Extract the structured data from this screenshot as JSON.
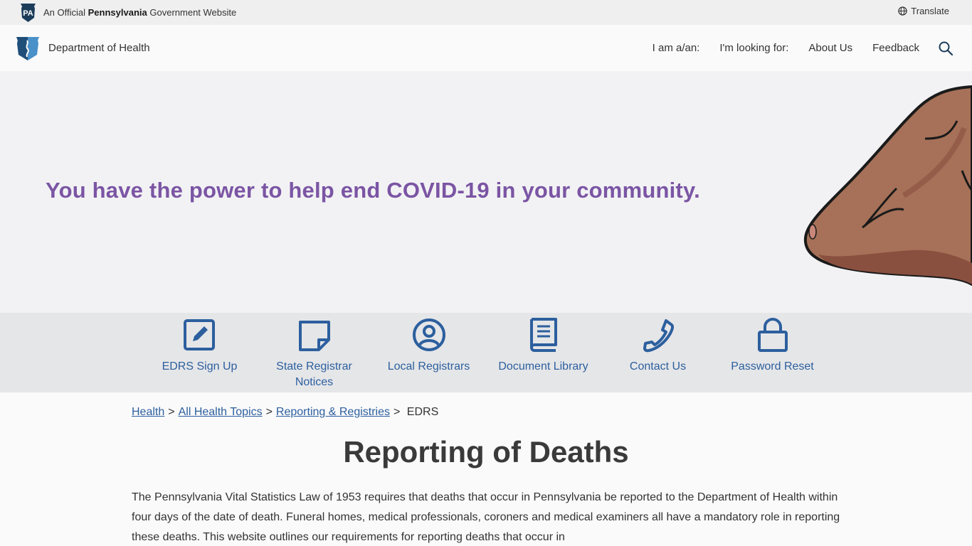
{
  "official_bar": {
    "logo_text": "PA",
    "prefix": "An Official",
    "state": "Pennsylvania",
    "suffix": "Government Website",
    "translate_label": "Translate"
  },
  "header": {
    "agency": "Department of Health",
    "nav": [
      {
        "label": "I am a/an:"
      },
      {
        "label": "I'm looking for:"
      },
      {
        "label": "About Us"
      },
      {
        "label": "Feedback"
      }
    ]
  },
  "hero": {
    "message": "You have the power to help end COVID-19 in your community."
  },
  "quick_links": [
    {
      "label": "EDRS Sign Up",
      "icon": "edit-square-icon"
    },
    {
      "label": "State Registrar Notices",
      "icon": "sticky-note-icon"
    },
    {
      "label": "Local Registrars",
      "icon": "user-circle-icon"
    },
    {
      "label": "Document Library",
      "icon": "book-icon"
    },
    {
      "label": "Contact Us",
      "icon": "phone-icon"
    },
    {
      "label": "Password Reset",
      "icon": "lock-icon"
    }
  ],
  "breadcrumb": {
    "items": [
      "Health",
      "All Health Topics",
      "Reporting & Registries"
    ],
    "current": "EDRS"
  },
  "page": {
    "title": "Reporting of Deaths",
    "intro": "The Pennsylvania Vital Statistics Law of 1953 requires that deaths that occur in Pennsylvania be reported to the Department of Health within four days of the date of death. Funeral homes, medical professionals, coroners and medical examiners all have a mandatory role in reporting these deaths. This website outlines our requirements for reporting deaths that occur in"
  },
  "colors": {
    "link_blue": "#2c5f9e",
    "hero_purple": "#7b55a4",
    "pa_navy": "#1c3d5a"
  }
}
